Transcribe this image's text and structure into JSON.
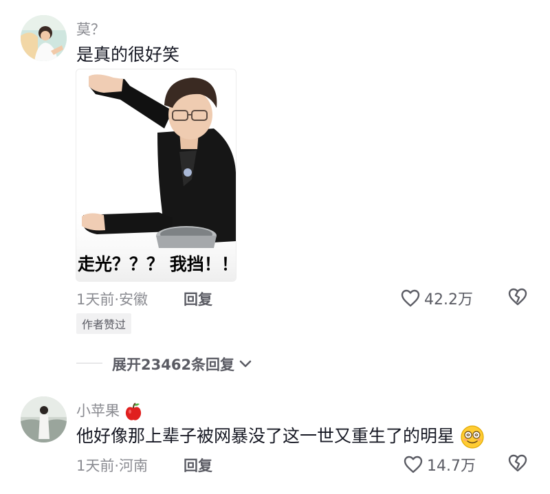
{
  "comments": [
    {
      "username": "莫？",
      "text": "是真的很好笑",
      "sticker_caption": "走光？？？ 我挡！！！",
      "time_location": "1天前·安徽",
      "reply_label": "回复",
      "likes": "42.2万",
      "badge": "作者赞过"
    },
    {
      "username": "小苹果",
      "text": "他好像那上辈子被网暴没了这一世又重生了的明星",
      "time_location": "1天前·河南",
      "reply_label": "回复",
      "likes": "14.7万"
    }
  ],
  "expand_replies": {
    "label": "展开23462条回复"
  },
  "icons": {
    "like": "heart-outline-icon",
    "dislike": "broken-heart-icon",
    "expand": "chevron-down-icon",
    "apple": "red-apple-emoji",
    "smile": "dizzy-face-emoji"
  },
  "colors": {
    "text_primary": "#161823",
    "text_secondary": "#8a8b91",
    "text_tertiary": "#5a5b63",
    "badge_bg": "#f1f1f2"
  }
}
